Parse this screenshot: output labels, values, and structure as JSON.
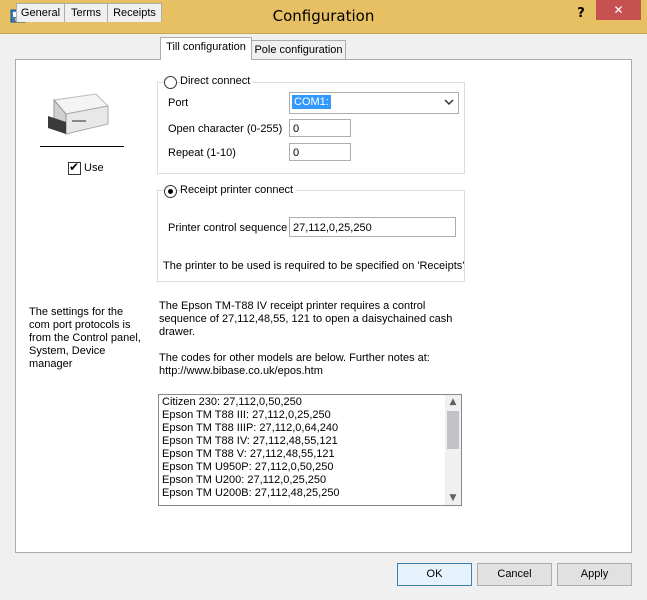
{
  "window": {
    "title": "Configuration",
    "help_label": "?",
    "close_label": "✕"
  },
  "tabs": [
    {
      "label": "General"
    },
    {
      "label": "Terms"
    },
    {
      "label": "Receipts"
    },
    {
      "label": "Till configuration",
      "active": true
    },
    {
      "label": "Pole configuration"
    }
  ],
  "drawer": {
    "use_label": "Use",
    "use_checked": true
  },
  "direct_connect": {
    "radio_label": "Direct connect",
    "selected": false,
    "port_label": "Port",
    "port_value": "COM1:",
    "open_char_label": "Open character (0-255)",
    "open_char_value": "0",
    "repeat_label": "Repeat (1-10)",
    "repeat_value": "0"
  },
  "receipt_printer": {
    "radio_label": "Receipt printer connect",
    "selected": true,
    "sequence_label": "Printer control sequence",
    "sequence_value": "27,112,0,25,250",
    "note": "The printer to be used is required to be specified on 'Receipts'"
  },
  "left_note": "The settings for the com port protocols is from the Control panel, System, Device manager",
  "epson_note": "The Epson TM-T88 IV receipt printer requires a control sequence of 27,112,48,55, 121 to open a daisychained cash drawer.",
  "codes_note": "The codes for other models are below. Further notes at: http://www.bibase.co.uk/epos.htm",
  "codes_list": [
    "Citizen 230: 27,112,0,50,250",
    "Epson TM T88 III: 27,112,0,25,250",
    "Epson TM T88 IIIP: 27,112,0,64,240",
    "Epson TM T88 IV: 27,112,48,55,121",
    "Epson TM T88 V: 27,112,48,55,121",
    "Epson TM U950P: 27,112,0,50,250",
    "Epson TM U200: 27,112,0,25,250",
    "Epson TM U200B: 27,112,48,25,250"
  ],
  "buttons": {
    "ok": "OK",
    "cancel": "Cancel",
    "apply": "Apply"
  },
  "colors": {
    "titlebar": "#e6c063",
    "close": "#c75050",
    "selection": "#3399ff"
  }
}
